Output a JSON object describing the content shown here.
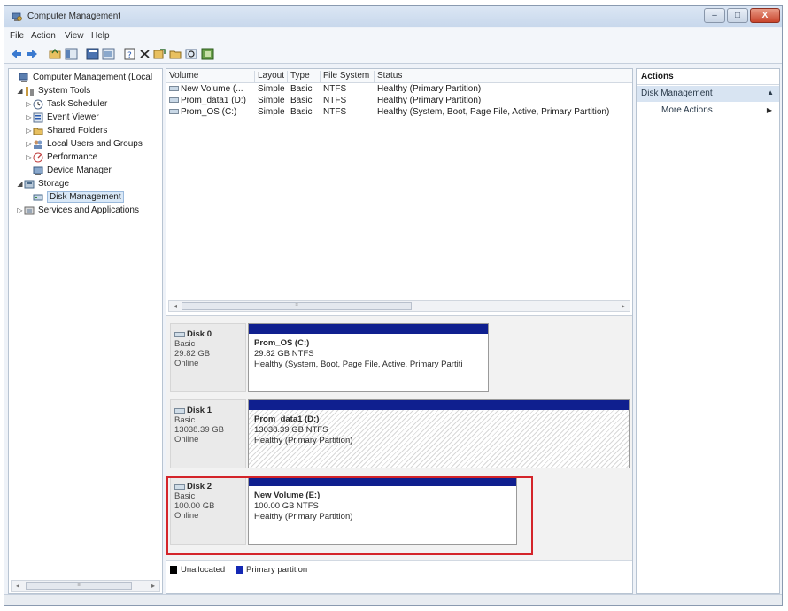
{
  "window": {
    "title": "Computer Management",
    "buttons": {
      "minimize": "–",
      "maximize": "□",
      "close": "X"
    }
  },
  "menu": [
    "File",
    "Action",
    "View",
    "Help"
  ],
  "toolbar_icons": [
    "back-arrow-icon",
    "forward-arrow-icon",
    "up-folder-icon",
    "show-hide-tree-icon",
    "properties-icon",
    "help-icon",
    "console-icon",
    "export-icon",
    "delete-icon",
    "open-icon",
    "folder-open-icon",
    "search-icon",
    "connect-icon"
  ],
  "tree": {
    "root": "Computer Management (Local",
    "system_tools": "System Tools",
    "task_scheduler": "Task Scheduler",
    "event_viewer": "Event Viewer",
    "shared_folders": "Shared Folders",
    "local_users": "Local Users and Groups",
    "performance": "Performance",
    "device_manager": "Device Manager",
    "storage": "Storage",
    "disk_management": "Disk Management",
    "services": "Services and Applications"
  },
  "volume_list": {
    "columns": [
      "Volume",
      "Layout",
      "Type",
      "File System",
      "Status"
    ],
    "rows": [
      {
        "volume": "New Volume (...",
        "layout": "Simple",
        "type": "Basic",
        "fs": "NTFS",
        "status": "Healthy (Primary Partition)"
      },
      {
        "volume": "Prom_data1 (D:)",
        "layout": "Simple",
        "type": "Basic",
        "fs": "NTFS",
        "status": "Healthy (Primary Partition)"
      },
      {
        "volume": "Prom_OS (C:)",
        "layout": "Simple",
        "type": "Basic",
        "fs": "NTFS",
        "status": "Healthy (System, Boot, Page File, Active, Primary Partition)"
      }
    ]
  },
  "disks": [
    {
      "name": "Disk 0",
      "type": "Basic",
      "size": "29.82 GB",
      "state": "Online",
      "partition": {
        "name": "Prom_OS (C:)",
        "size_fs": "29.82 GB NTFS",
        "status": "Healthy (System, Boot, Page File, Active, Primary Partiti"
      }
    },
    {
      "name": "Disk 1",
      "type": "Basic",
      "size": "13038.39 GB",
      "state": "Online",
      "partition": {
        "name": "Prom_data1 (D:)",
        "size_fs": "13038.39 GB NTFS",
        "status": "Healthy (Primary Partition)"
      }
    },
    {
      "name": "Disk 2",
      "type": "Basic",
      "size": "100.00 GB",
      "state": "Online",
      "partition": {
        "name": "New Volume (E:)",
        "size_fs": "100.00 GB NTFS",
        "status": "Healthy (Primary Partition)"
      }
    }
  ],
  "legend": {
    "unallocated": "Unallocated",
    "primary": "Primary partition"
  },
  "actions": {
    "header": "Actions",
    "section": "Disk Management",
    "more": "More Actions"
  },
  "colors": {
    "partition_bar": "#0f1f8f",
    "highlight": "#d4242a",
    "unallocated": "#000000",
    "primary": "#1428b4"
  }
}
